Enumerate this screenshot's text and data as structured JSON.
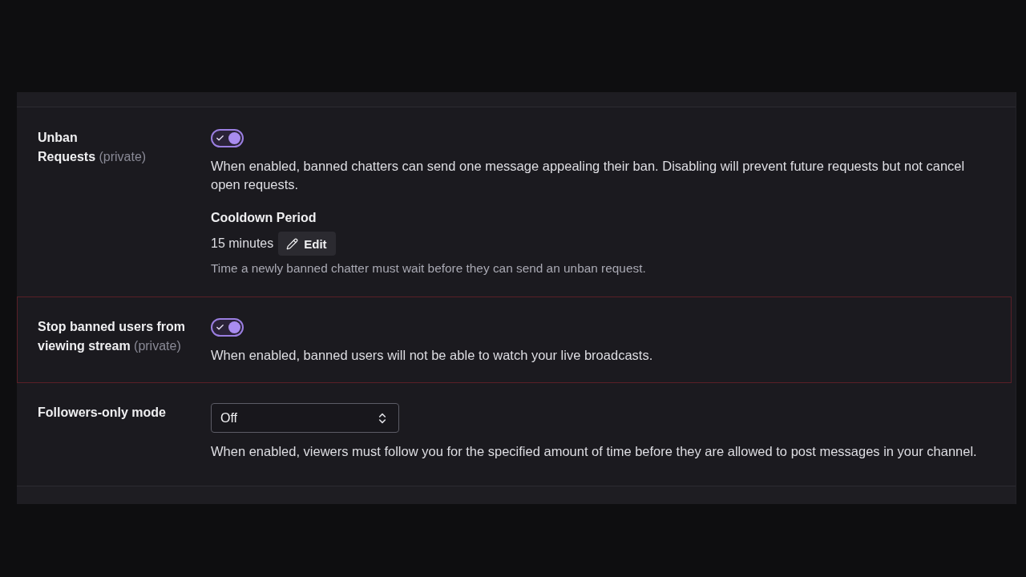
{
  "settings": [
    {
      "kind": "toggle",
      "label": "Unban Requests",
      "privacy": "(private)",
      "on": true,
      "highlighted": false,
      "description": "When enabled, banned chatters can send one message appealing their ban. Disabling will prevent future requests but not cancel open requests.",
      "sub_setting": {
        "title": "Cooldown Period",
        "value": "15 minutes",
        "button": "Edit",
        "hint": "Time a newly banned chatter must wait before they can send an unban request."
      }
    },
    {
      "kind": "toggle",
      "label": "Stop banned users from viewing stream",
      "privacy": "(private)",
      "on": true,
      "highlighted": true,
      "description": "When enabled, banned users will not be able to watch your live broadcasts."
    },
    {
      "kind": "select",
      "label": "Followers-only mode",
      "value": "Off",
      "highlighted": false,
      "description": "When enabled, viewers must follow you for the specified amount of time before they are allowed to post messages in your channel."
    }
  ]
}
